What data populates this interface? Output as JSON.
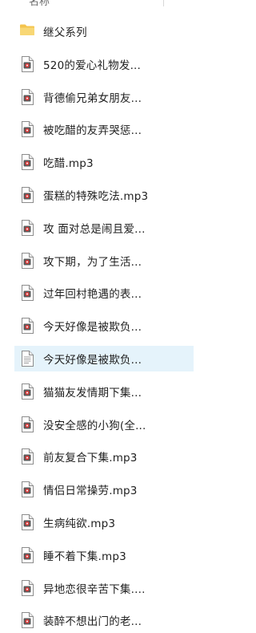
{
  "header": {
    "column_label": "名称"
  },
  "files": [
    {
      "name": "继父系列",
      "type": "folder",
      "selected": false
    },
    {
      "name": "520的爱心礼物发...",
      "type": "audio",
      "selected": false
    },
    {
      "name": "背德偷兄弟女朋友...",
      "type": "audio",
      "selected": false
    },
    {
      "name": "被吃醋的友弄哭惩...",
      "type": "audio",
      "selected": false
    },
    {
      "name": "吃醋.mp3",
      "type": "audio",
      "selected": false
    },
    {
      "name": "蛋糕的特殊吃法.mp3",
      "type": "audio",
      "selected": false
    },
    {
      "name": "攻 面对总是闹且爱...",
      "type": "audio",
      "selected": false
    },
    {
      "name": "攻下期，为了生活...",
      "type": "audio",
      "selected": false
    },
    {
      "name": "过年回村艳遇的表...",
      "type": "audio",
      "selected": false
    },
    {
      "name": "今天好像是被欺负...",
      "type": "audio",
      "selected": false
    },
    {
      "name": "今天好像是被欺负...",
      "type": "text",
      "selected": true
    },
    {
      "name": "猫猫友发情期下集...",
      "type": "audio",
      "selected": false
    },
    {
      "name": "没安全感的小狗(全...",
      "type": "audio",
      "selected": false
    },
    {
      "name": "前友复合下集.mp3",
      "type": "audio",
      "selected": false
    },
    {
      "name": "情侣日常操劳.mp3",
      "type": "audio",
      "selected": false
    },
    {
      "name": "生病纯欲.mp3",
      "type": "audio",
      "selected": false
    },
    {
      "name": "睡不着下集.mp3",
      "type": "audio",
      "selected": false
    },
    {
      "name": "异地恋很辛苦下集....",
      "type": "audio",
      "selected": false
    },
    {
      "name": "装醉不想出门的老...",
      "type": "audio",
      "selected": false
    }
  ]
}
